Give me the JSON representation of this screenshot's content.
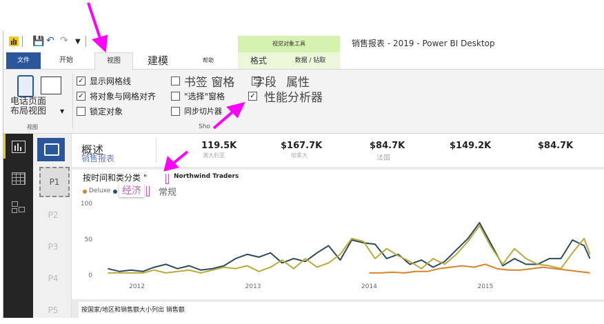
{
  "window": {
    "title": "销售报表 -   2019 - Power BI Desktop",
    "contextual_group": "视觉对象工具"
  },
  "tabs": [
    {
      "label": "文件"
    },
    {
      "label": "开始"
    },
    {
      "label": "视图"
    },
    {
      "label": "建模"
    },
    {
      "label": "帮助"
    },
    {
      "label": "格式"
    },
    {
      "label": "数据 / 钻取"
    }
  ],
  "ribbon": {
    "phone_layout_label": "电话页面\n布局视图",
    "view_group_label": "视图",
    "show_group_label": "Sho",
    "checks": [
      {
        "label": "显示网格线",
        "checked": true
      },
      {
        "label": "将对象与网格对齐",
        "checked": true
      },
      {
        "label": "锁定对象",
        "checked": false
      },
      {
        "label": "书签 窗格",
        "checked": false
      },
      {
        "label": "字段",
        "checked": false
      },
      {
        "label": "属性",
        "checked": false
      },
      {
        "label": "\"选择\"窗格",
        "checked": false
      },
      {
        "label": "性能分析器",
        "checked": true
      },
      {
        "label": "同步切片器",
        "checked": false
      }
    ]
  },
  "pages": [
    {
      "label": "P1"
    },
    {
      "label": "P2"
    },
    {
      "label": "P3"
    },
    {
      "label": "P4"
    },
    {
      "label": "P5"
    }
  ],
  "header_card": {
    "title": "概述",
    "subtitle": "销售报表",
    "kpis": [
      {
        "value": "119.5K",
        "label": "澳大利亚"
      },
      {
        "value": "$167.7K",
        "label": "加拿大"
      },
      {
        "value": "$84.7K",
        "label": "法国"
      },
      {
        "value": "$149.2K",
        "label": ""
      },
      {
        "value": "$84.7K",
        "label": ""
      }
    ]
  },
  "visual_toolbar": {
    "icons": [
      "up-arrow-icon",
      "down-arrow-icon",
      "double-down-icon",
      "expand-hierarchy-icon",
      "focus-mode-icon",
      "filter-icon",
      "more-options-icon"
    ]
  },
  "chart_card": {
    "title": "按时间和类分类 \"",
    "brand": "Northwind Traders",
    "legend": [
      {
        "name": "Deluxe",
        "color": "#d9822b"
      },
      {
        "name": "经济",
        "color": "#2d4a5a"
      },
      {
        "name": "常规",
        "color": "#b9aa3a"
      }
    ],
    "bottom_title": "按国家/地区和销售额大小列出 销售额"
  },
  "chart_data": {
    "type": "line",
    "xlabel": "",
    "ylabel": "",
    "ylim": [
      0,
      100
    ],
    "yticks": [
      0,
      50,
      100
    ],
    "xticks": [
      "2012",
      "2013",
      "2014",
      "2015"
    ],
    "series": [
      {
        "name": "经济",
        "color": "#2d4a5a",
        "x": [
          2011.75,
          2011.85,
          2011.95,
          2012.05,
          2012.15,
          2012.25,
          2012.35,
          2012.45,
          2012.55,
          2012.65,
          2012.75,
          2012.85,
          2012.95,
          2013.05,
          2013.15,
          2013.25,
          2013.35,
          2013.45,
          2013.55,
          2013.65,
          2013.75,
          2013.85,
          2013.95,
          2014.05,
          2014.15,
          2014.25,
          2014.35,
          2014.45,
          2014.55,
          2014.65,
          2014.75,
          2014.85,
          2014.95,
          2015.05,
          2015.15,
          2015.25,
          2015.35,
          2015.45,
          2015.55,
          2015.65,
          2015.75,
          2015.85,
          2015.9
        ],
        "values": [
          8,
          4,
          6,
          4,
          10,
          14,
          8,
          12,
          6,
          8,
          12,
          22,
          28,
          24,
          30,
          16,
          22,
          18,
          30,
          40,
          20,
          48,
          44,
          42,
          22,
          28,
          14,
          20,
          10,
          18,
          34,
          50,
          72,
          42,
          12,
          22,
          14,
          14,
          22,
          22,
          48,
          40,
          22
        ]
      },
      {
        "name": "常规",
        "color": "#b9aa3a",
        "x": [
          2011.75,
          2011.85,
          2011.95,
          2012.05,
          2012.15,
          2012.25,
          2012.35,
          2012.45,
          2012.55,
          2012.65,
          2012.75,
          2012.85,
          2012.95,
          2013.05,
          2013.15,
          2013.25,
          2013.35,
          2013.45,
          2013.55,
          2013.65,
          2013.75,
          2013.85,
          2013.95,
          2014.05,
          2014.15,
          2014.25,
          2014.35,
          2014.45,
          2014.55,
          2014.65,
          2014.75,
          2014.85,
          2014.95,
          2015.05,
          2015.15,
          2015.25,
          2015.35,
          2015.45,
          2015.55,
          2015.65,
          2015.75,
          2015.85,
          2015.9
        ],
        "values": [
          2,
          2,
          2,
          2,
          6,
          2,
          4,
          6,
          2,
          6,
          10,
          8,
          12,
          4,
          10,
          20,
          8,
          22,
          10,
          16,
          28,
          50,
          46,
          22,
          36,
          26,
          18,
          8,
          22,
          14,
          28,
          46,
          68,
          38,
          14,
          36,
          22,
          14,
          12,
          8,
          30,
          50,
          28
        ]
      },
      {
        "name": "Deluxe",
        "color": "#d9822b",
        "x": [
          2014.0,
          2014.1,
          2014.2,
          2014.3,
          2014.4,
          2014.5,
          2014.6,
          2014.7,
          2014.8,
          2014.9,
          2015.0,
          2015.1,
          2015.2,
          2015.3,
          2015.4,
          2015.5,
          2015.6,
          2015.7,
          2015.8,
          2015.9
        ],
        "values": [
          2,
          2,
          3,
          2,
          4,
          4,
          8,
          10,
          12,
          10,
          14,
          8,
          6,
          6,
          8,
          10,
          8,
          6,
          4,
          2
        ]
      }
    ]
  }
}
